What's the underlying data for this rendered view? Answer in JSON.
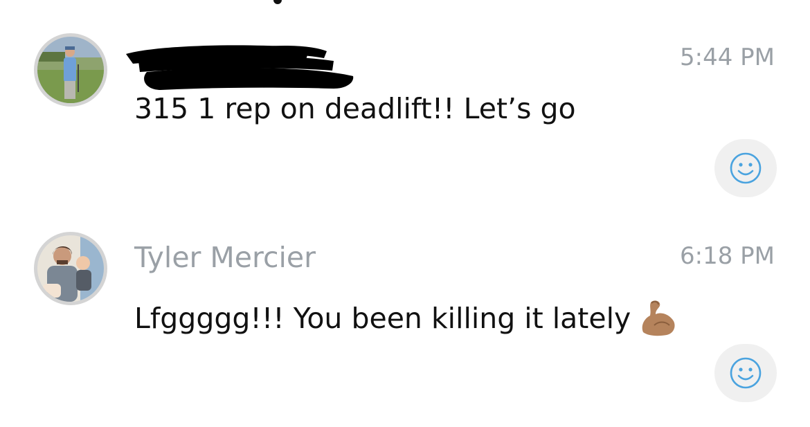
{
  "messages": [
    {
      "sender": "",
      "sender_redacted": true,
      "time": "5:44 PM",
      "text": "315 1 rep on deadlift!! Let’s go",
      "avatar_icon": "avatar-golfer-photo",
      "reaction_icon": "smiley-face-icon"
    },
    {
      "sender": "Tyler Mercier",
      "time": "6:18 PM",
      "text": "Lfggggg!!! You been killing it lately",
      "emoji": "flexed-biceps-icon",
      "avatar_icon": "avatar-father-child-photo",
      "reaction_icon": "smiley-face-icon"
    }
  ],
  "colors": {
    "meta_gray": "#9aa0a6",
    "text": "#111111",
    "react_bg": "#f0f0f0",
    "react_icon": "#4aa3df",
    "avatar_ring": "#d4d4d4"
  }
}
